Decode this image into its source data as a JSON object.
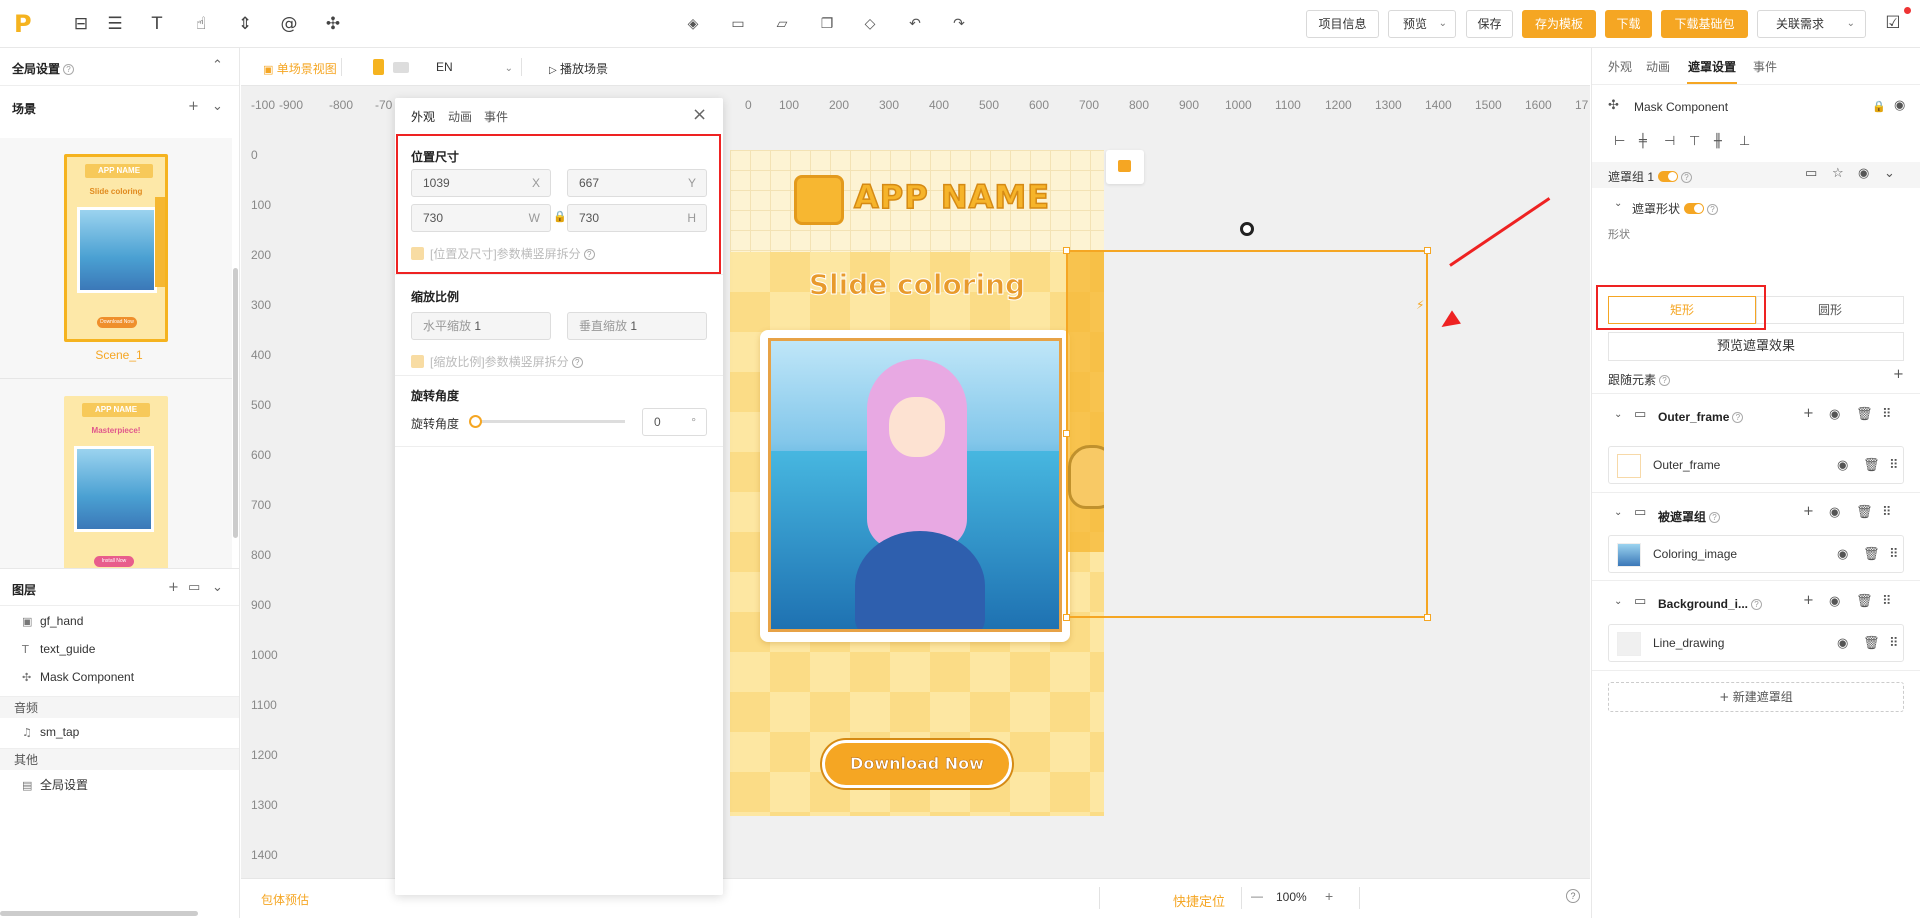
{
  "toolbar": {
    "logo": "P",
    "project_info": "项目信息",
    "preview": "预览",
    "save": "保存",
    "save_template": "存为模板",
    "download": "下载",
    "download_base": "下载基础包",
    "related": "关联需求"
  },
  "left": {
    "global_settings": "全局设置",
    "scenes_title": "场景",
    "scene1_name": "Scene_1",
    "thumb1_app": "APP NAME",
    "thumb1_title": "Slide coloring",
    "thumb1_btn": "Download Now",
    "thumb2_app": "APP NAME",
    "thumb2_title": "Masterpiece!",
    "thumb2_btn": "Install Now",
    "layers_title": "图层",
    "layers": [
      "gf_hand",
      "text_guide",
      "Mask Component"
    ],
    "audio_title": "音频",
    "audio_item": "sm_tap",
    "other_title": "其他",
    "other_item": "全局设置"
  },
  "canvas": {
    "single_view": "单场景视图",
    "lang": "EN",
    "play_scene": "播放场景",
    "ruler_h": [
      "-100",
      "-900",
      "-800",
      "-70",
      "0",
      "100",
      "200",
      "300",
      "400",
      "500",
      "600",
      "700",
      "800",
      "900",
      "1000",
      "1100",
      "1200",
      "1300",
      "1400",
      "1500",
      "1600",
      "17"
    ],
    "ruler_v": [
      "0",
      "100",
      "200",
      "300",
      "400",
      "500",
      "600",
      "700",
      "800",
      "900",
      "1000",
      "1100",
      "1200",
      "1300",
      "1400"
    ],
    "package_estimate": "包体预估",
    "quick_locate": "快捷定位",
    "zoom": "100%",
    "zoom_minus": "—",
    "zoom_plus": "+"
  },
  "scene": {
    "app_name": "APP NAME",
    "title": "Slide coloring",
    "download_btn": "Download Now"
  },
  "popup": {
    "tabs": [
      "外观",
      "动画",
      "事件"
    ],
    "pos_size_title": "位置尺寸",
    "x": "1039",
    "x_label": "X",
    "y": "667",
    "y_label": "Y",
    "w": "730",
    "w_label": "W",
    "h": "730",
    "h_label": "H",
    "split_pos": "[位置及尺寸]参数横竖屏拆分",
    "scale_title": "缩放比例",
    "h_scale_label": "水平缩放",
    "h_scale": "1",
    "v_scale_label": "垂直缩放",
    "v_scale": "1",
    "split_scale": "[缩放比例]参数横竖屏拆分",
    "rotation_title": "旋转角度",
    "rotation_label": "旋转角度",
    "rotation": "0",
    "rotation_unit": "°",
    "rotation_value": 0
  },
  "right": {
    "tabs": [
      "外观",
      "动画",
      "遮罩设置",
      "事件"
    ],
    "component": "Mask Component",
    "mask_group": "遮罩组 1",
    "mask_shape": "遮罩形状",
    "shape_label": "形状",
    "rect": "矩形",
    "circle": "圆形",
    "preview_mask": "预览遮罩效果",
    "follow": "跟随元素",
    "outer_frame_group": "Outer_frame",
    "outer_frame_item": "Outer_frame",
    "masked_group": "被遮罩组",
    "coloring_item": "Coloring_image",
    "bg_group": "Background_i...",
    "line_item": "Line_drawing",
    "new_group": "新建遮罩组"
  },
  "colors": {
    "accent": "#f5a623",
    "highlight": "#e22222"
  }
}
